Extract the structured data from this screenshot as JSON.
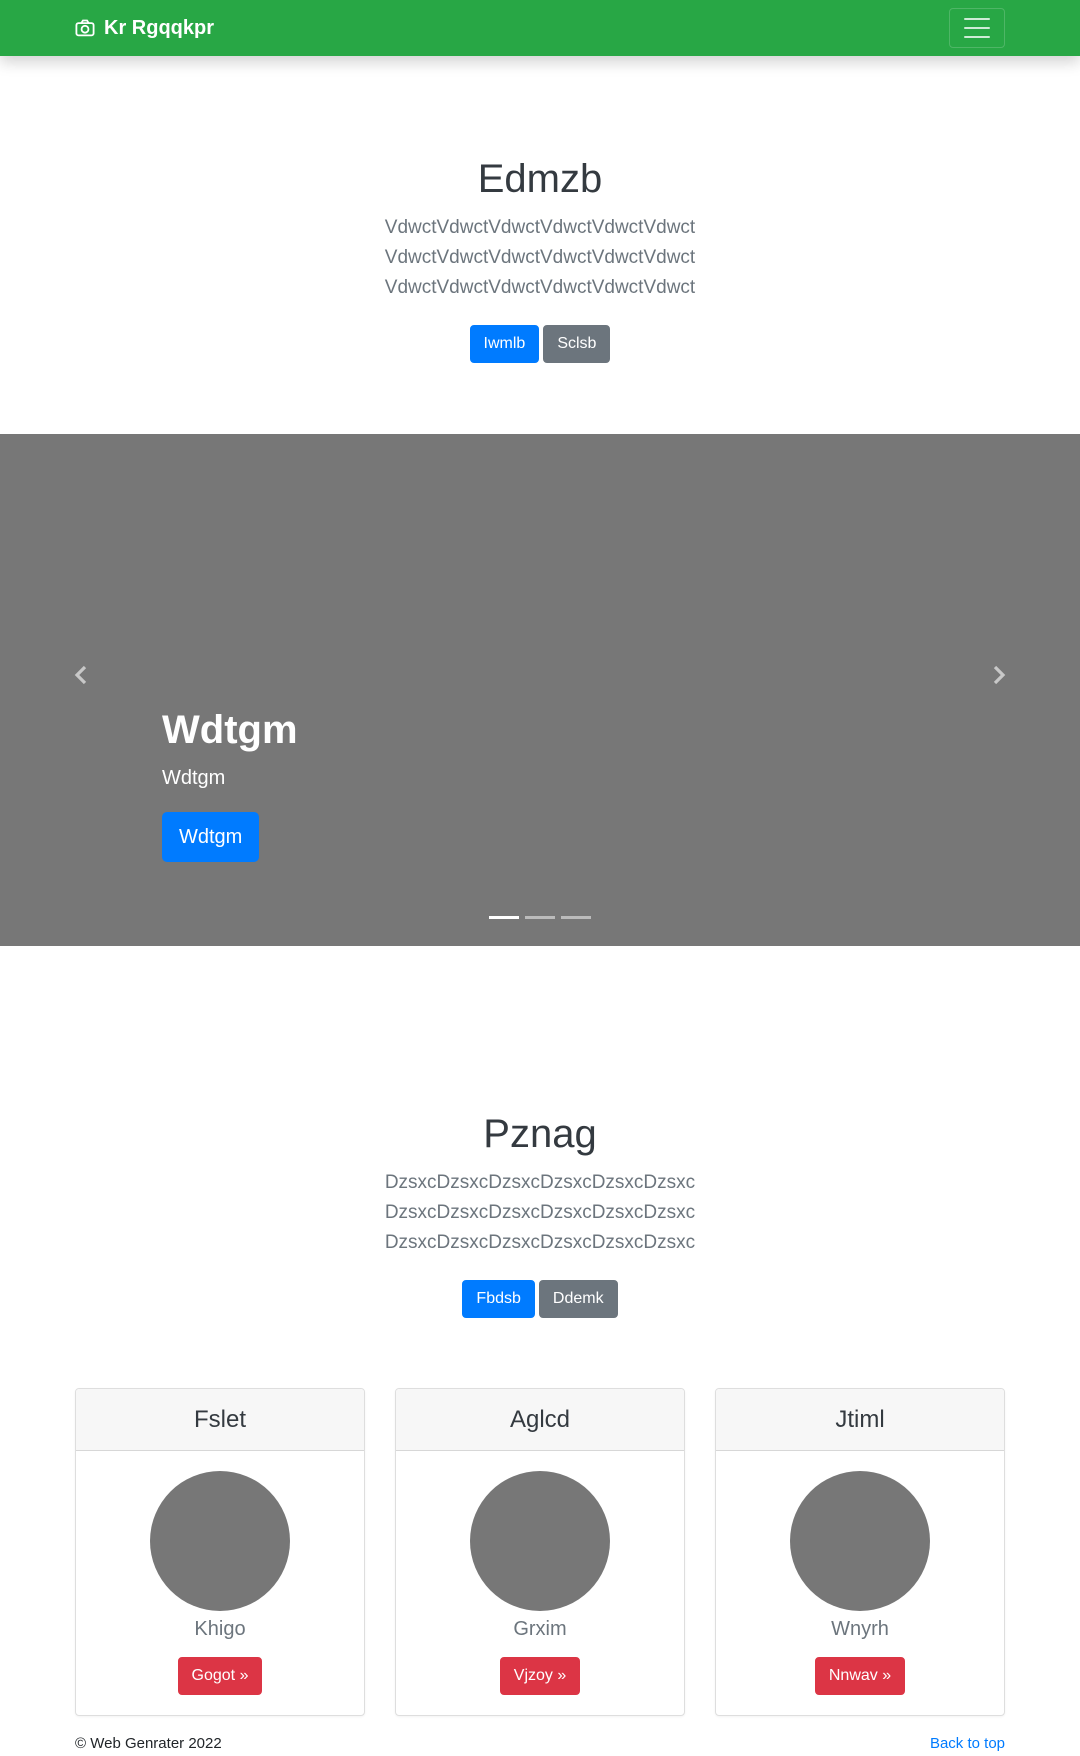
{
  "navbar": {
    "brand": "Kr Rgqqkpr",
    "brand_icon": "camera-icon",
    "toggler_icon": "hamburger-menu-icon",
    "background": "#28a745"
  },
  "hero": {
    "title": "Edmzb",
    "text": "VdwctVdwctVdwctVdwctVdwctVdwct VdwctVdwctVdwctVdwctVdwctVdwct VdwctVdwctVdwctVdwctVdwctVdwct",
    "primary_button": "Iwmlb",
    "secondary_button": "Sclsb"
  },
  "carousel": {
    "title": "Wdtgm",
    "subtitle": "Wdtgm",
    "button": "Wdtgm",
    "slides": 3,
    "active_slide": 1,
    "prev_icon": "chevron-left-icon",
    "next_icon": "chevron-right-icon",
    "background": "#777777"
  },
  "album": {
    "title": "Pznag",
    "text": "DzsxcDzsxcDzsxcDzsxcDzsxcDzsxc DzsxcDzsxcDzsxcDzsxcDzsxcDzsxc DzsxcDzsxcDzsxcDzsxcDzsxcDzsxc",
    "primary_button": "Fbdsb",
    "secondary_button": "Ddemk"
  },
  "cards": [
    {
      "header": "Fslet",
      "name": "Khigo",
      "button": "Gogot »"
    },
    {
      "header": "Aglcd",
      "name": "Grxim",
      "button": "Vjzoy »"
    },
    {
      "header": "Jtiml",
      "name": "Wnyrh",
      "button": "Nnwav »"
    }
  ],
  "footer": {
    "copyright": "© Web Genrater 2022",
    "back_to_top": "Back to top"
  },
  "colors": {
    "primary": "#007bff",
    "secondary": "#6c757d",
    "danger": "#dc3545",
    "success": "#28a745"
  }
}
